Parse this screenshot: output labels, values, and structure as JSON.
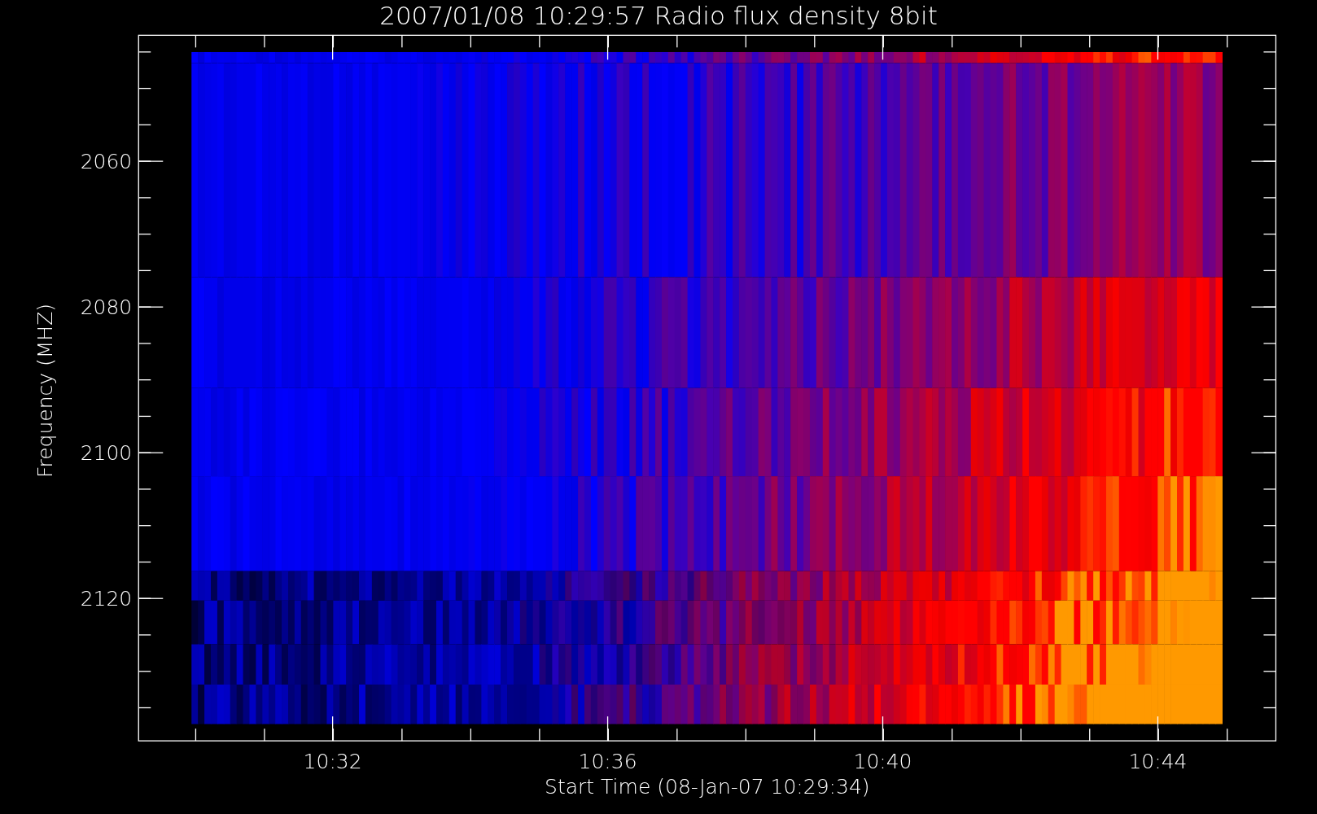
{
  "title": "2007/01/08 10:29:57 Radio flux density 8bit",
  "y_axis": {
    "label": "Frequency (MHZ)",
    "tick_labels": [
      "2060",
      "2080",
      "2100",
      "2120"
    ]
  },
  "x_axis": {
    "label": "Start Time (08-Jan-07 10:29:34)",
    "tick_labels": [
      "10:32",
      "10:36",
      "10:40",
      "10:44"
    ]
  }
}
